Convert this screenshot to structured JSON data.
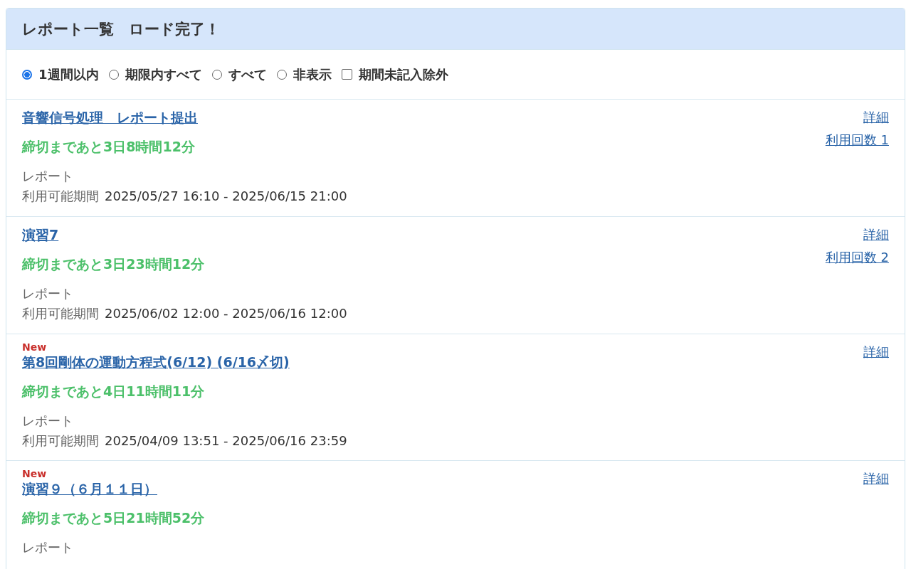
{
  "panel": {
    "title": "レポート一覧　ロード完了！"
  },
  "filters": [
    {
      "kind": "radio",
      "label": "1週間以内",
      "selected": true
    },
    {
      "kind": "radio",
      "label": "期限内すべて",
      "selected": false
    },
    {
      "kind": "radio",
      "label": "すべて",
      "selected": false
    },
    {
      "kind": "radio",
      "label": "非表示",
      "selected": false
    },
    {
      "kind": "checkbox",
      "label": "期間未記入除外",
      "checked": false
    }
  ],
  "reports": [
    {
      "title": "音響信号処理　レポート提出",
      "deadline": "締切まであと3日8時間12分",
      "type": "レポート",
      "period_label": "利用可能期間",
      "period": "2025/05/27 16:10 - 2025/06/15 21:00",
      "detail_link": "詳細",
      "usage_link": "利用回数 1"
    },
    {
      "title": "演習7",
      "deadline": "締切まであと3日23時間12分",
      "type": "レポート",
      "period_label": "利用可能期間",
      "period": "2025/06/02 12:00 - 2025/06/16 12:00",
      "detail_link": "詳細",
      "usage_link": "利用回数 2"
    },
    {
      "new_badge": "New",
      "title": "第8回剛体の運動方程式(6/12) (6/16〆切)",
      "deadline": "締切まであと4日11時間11分",
      "type": "レポート",
      "period_label": "利用可能期間",
      "period": "2025/04/09 13:51 - 2025/06/16 23:59",
      "detail_link": "詳細"
    },
    {
      "new_badge": "New",
      "title": "演習９（６月１１日）",
      "deadline": "締切まであと5日21時間52分",
      "type": "レポート",
      "detail_link": "詳細"
    }
  ]
}
